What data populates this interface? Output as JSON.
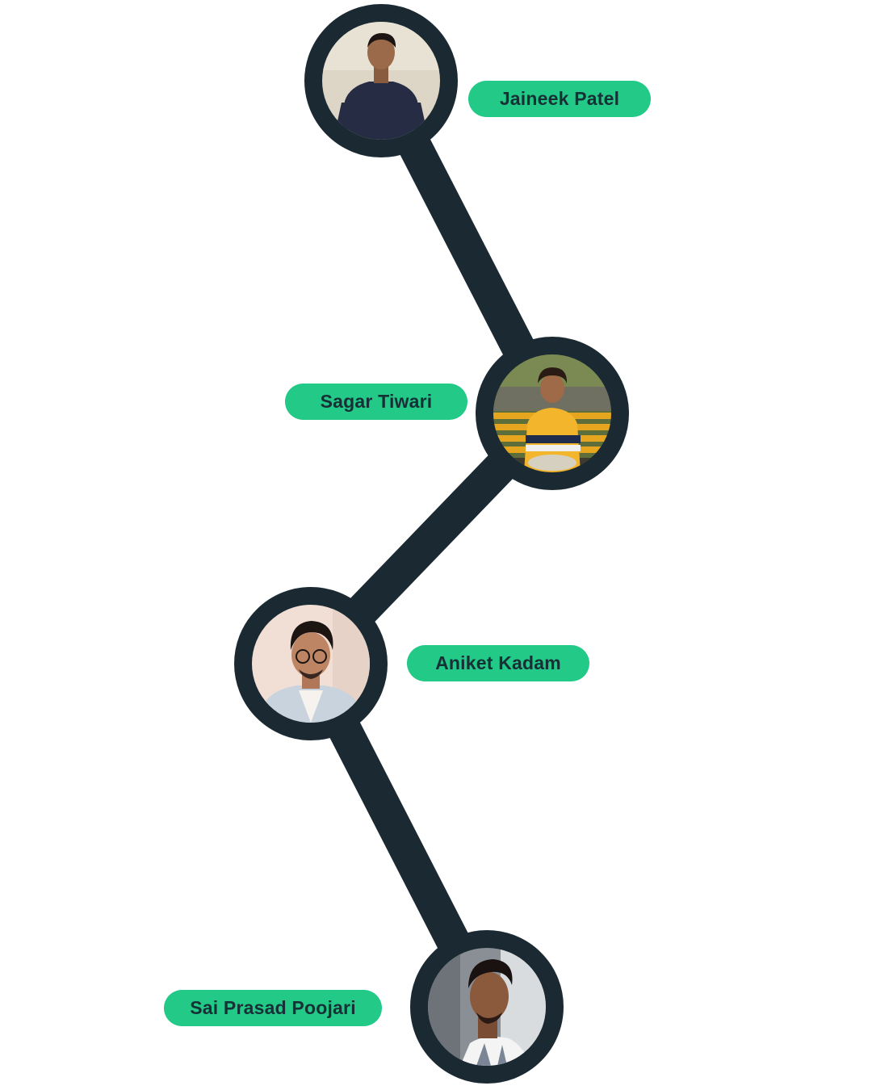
{
  "colors": {
    "line": "#1b2a32",
    "ring": "#1b2a32",
    "label_bg": "#22c987",
    "label_text": "#173036",
    "background": "#ffffff"
  },
  "members": [
    {
      "name": "Jaineek Patel",
      "photo": "person-photo"
    },
    {
      "name": "Sagar Tiwari",
      "photo": "person-photo"
    },
    {
      "name": "Aniket Kadam",
      "photo": "person-photo"
    },
    {
      "name": "Sai Prasad Poojari",
      "photo": "person-photo"
    }
  ]
}
